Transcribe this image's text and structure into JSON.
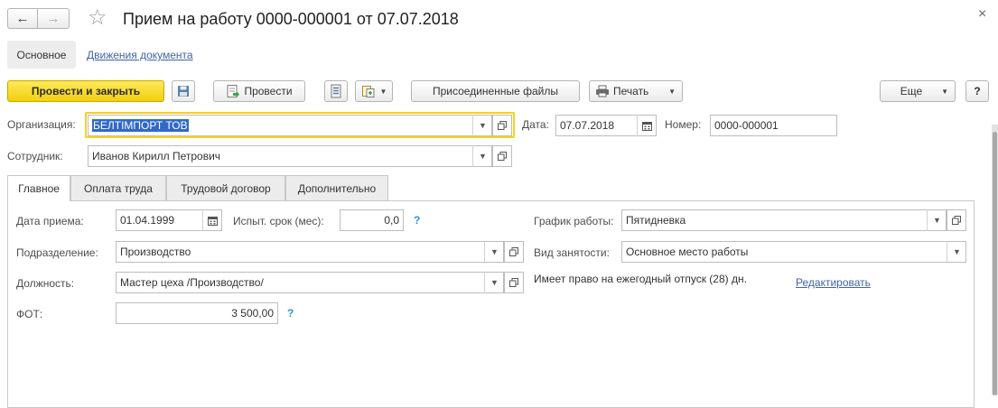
{
  "window": {
    "title": "Прием на работу 0000-000001 от 07.07.2018",
    "close_glyph": "×",
    "back_glyph": "←",
    "forward_glyph": "→",
    "favorite_glyph": "☆"
  },
  "nav": {
    "main": "Основное",
    "movements": "Движения документа"
  },
  "toolbar": {
    "post_close": "Провести и закрыть",
    "post": "Провести",
    "attached": "Присоединенные файлы",
    "print": "Печать",
    "more": "Еще",
    "help": "?"
  },
  "header": {
    "org_label": "Организация:",
    "org_value": "БЕЛТІМПОРТ ТОВ",
    "date_label": "Дата:",
    "date_value": "07.07.2018",
    "number_label": "Номер:",
    "number_value": "0000-000001",
    "employee_label": "Сотрудник:",
    "employee_value": "Иванов Кирилл Петрович"
  },
  "tabs": [
    {
      "label": "Главное"
    },
    {
      "label": "Оплата труда"
    },
    {
      "label": "Трудовой договор"
    },
    {
      "label": "Дополнительно"
    }
  ],
  "main": {
    "hire_date_label": "Дата приема:",
    "hire_date_value": "01.04.1999",
    "probation_label": "Испыт. срок (мес):",
    "probation_value": "0,0",
    "department_label": "Подразделение:",
    "department_value": "Производство",
    "position_label": "Должность:",
    "position_value": "Мастер цеха /Производство/",
    "fot_label": "ФОТ:",
    "fot_value": "3 500,00",
    "schedule_label": "График работы:",
    "schedule_value": "Пятидневка",
    "employment_label": "Вид занятости:",
    "employment_value": "Основное место работы",
    "vacation_text": "Имеет право на ежегодный отпуск (28) дн.",
    "edit_link": "Редактировать",
    "hint": "?"
  },
  "colors": {
    "accent_yellow": "#f5d31c",
    "link_blue": "#4065a8",
    "selection_blue": "#3169c6",
    "hint_blue": "#3a8fd8"
  }
}
